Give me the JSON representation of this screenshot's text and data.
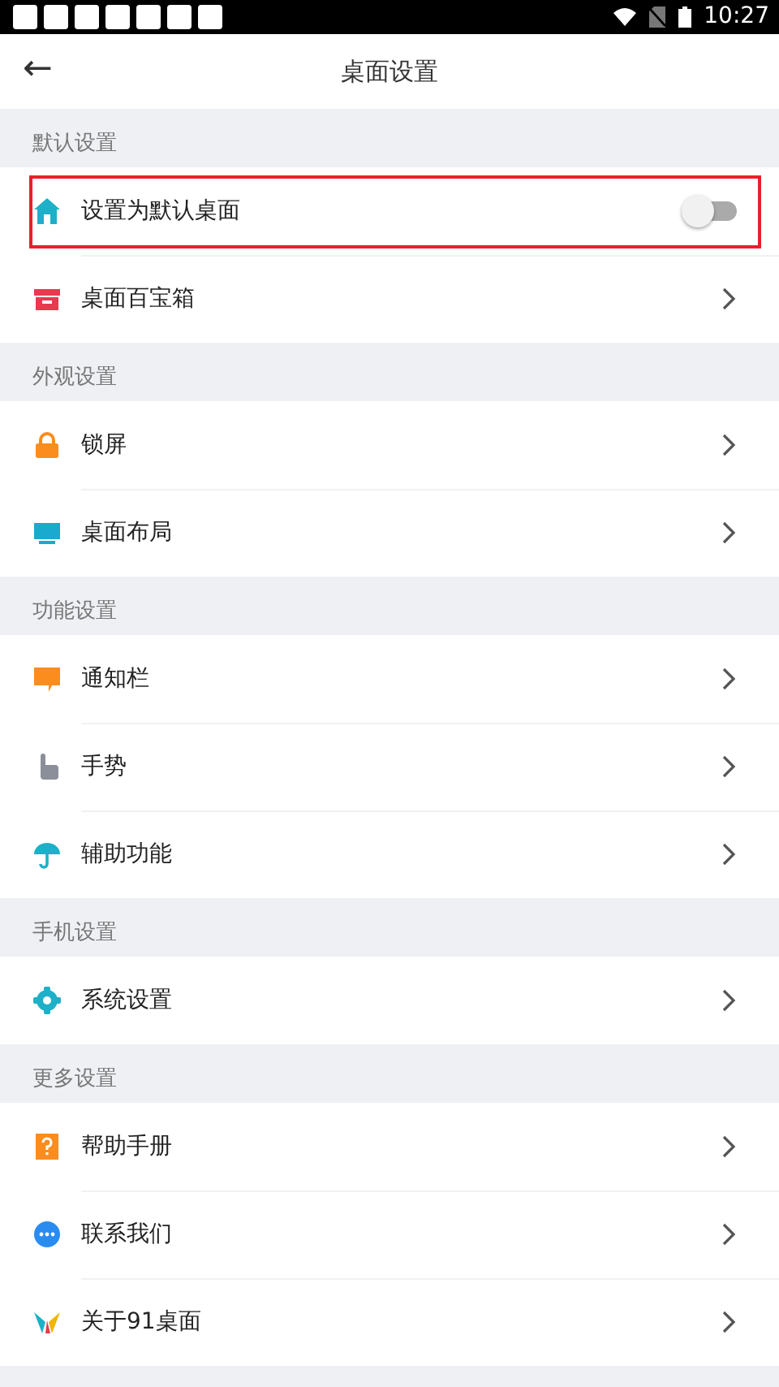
{
  "status_bar": {
    "time": "10:27"
  },
  "header": {
    "title": "桌面设置",
    "back": "←"
  },
  "sections": [
    {
      "title": "默认设置",
      "items": [
        {
          "label": "设置为默认桌面",
          "kind": "toggle",
          "on": false,
          "highlighted": true
        },
        {
          "label": "桌面百宝箱",
          "kind": "link"
        }
      ]
    },
    {
      "title": "外观设置",
      "items": [
        {
          "label": "锁屏",
          "kind": "link"
        },
        {
          "label": "桌面布局",
          "kind": "link"
        }
      ]
    },
    {
      "title": "功能设置",
      "items": [
        {
          "label": "通知栏",
          "kind": "link"
        },
        {
          "label": "手势",
          "kind": "link"
        },
        {
          "label": "辅助功能",
          "kind": "link"
        }
      ]
    },
    {
      "title": "手机设置",
      "items": [
        {
          "label": "系统设置",
          "kind": "link"
        }
      ]
    },
    {
      "title": "更多设置",
      "items": [
        {
          "label": "帮助手册",
          "kind": "link"
        },
        {
          "label": "联系我们",
          "kind": "link"
        },
        {
          "label": "关于91桌面",
          "kind": "link"
        }
      ]
    }
  ]
}
